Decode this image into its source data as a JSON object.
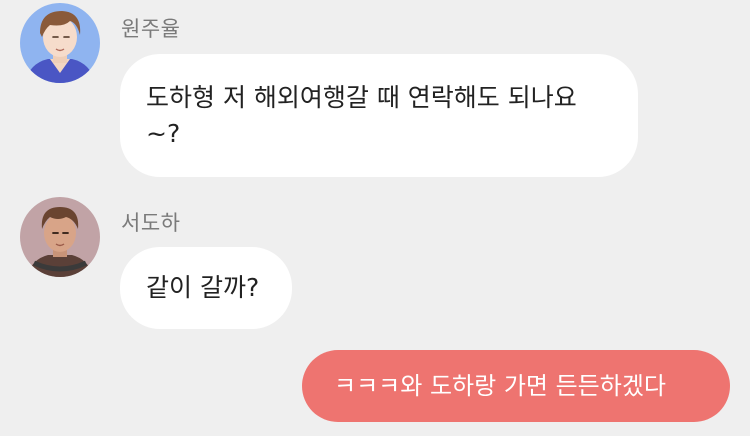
{
  "messages": [
    {
      "sender": "원주율",
      "text": "도하형 저 해외여행갈 때 연락해도 되나요 ~?",
      "side": "left",
      "avatar": "young-man-blue-shirt-avatar"
    },
    {
      "sender": "서도하",
      "text": "같이 갈까?",
      "side": "left",
      "avatar": "young-man-dark-hair-headphones-avatar"
    },
    {
      "sender": "",
      "text": "ㅋㅋㅋ와 도하랑 가면 든든하겠다",
      "side": "right"
    }
  ],
  "colors": {
    "background": "#efefef",
    "incoming_bubble": "#ffffff",
    "outgoing_bubble": "#ee7470",
    "sender_name": "#7a7a7a"
  }
}
